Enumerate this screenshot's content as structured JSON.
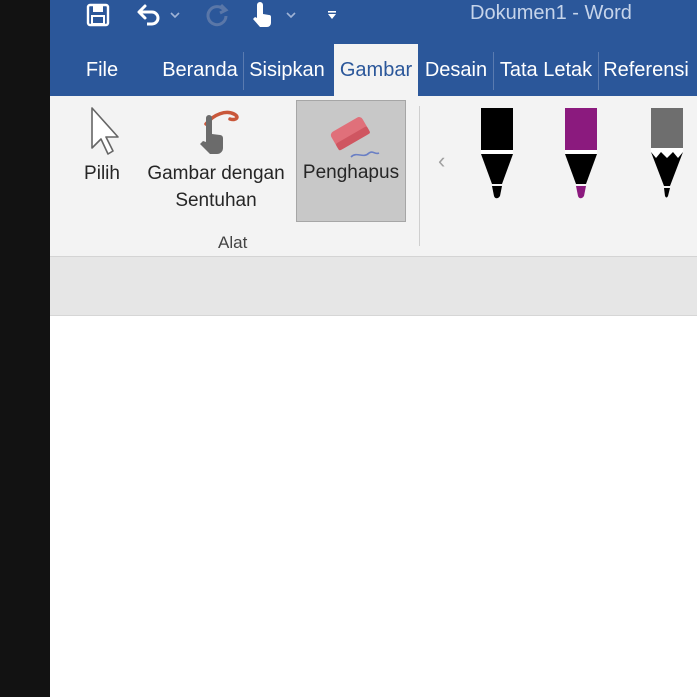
{
  "window": {
    "title": "Dokumen1  -  Word"
  },
  "quick_access": {
    "save_icon": "save-icon",
    "undo_icon": "undo-icon",
    "redo_icon": "redo-icon",
    "touch_mode_icon": "touch-mode-icon",
    "customize_icon": "customize-toolbar-icon"
  },
  "tabs": [
    {
      "label": "File"
    },
    {
      "label": "Beranda"
    },
    {
      "label": "Sisipkan"
    },
    {
      "label": "Gambar",
      "active": true
    },
    {
      "label": "Desain"
    },
    {
      "label": "Tata Letak"
    },
    {
      "label": "Referensi"
    }
  ],
  "ribbon": {
    "tools_group": {
      "label": "Alat",
      "select": {
        "label": "Pilih"
      },
      "touch_draw": {
        "line1": "Gambar dengan",
        "line2": "Sentuhan"
      },
      "eraser": {
        "label": "Penghapus",
        "selected": true
      }
    },
    "pens": [
      {
        "name": "pen-black",
        "color": "#000000"
      },
      {
        "name": "pen-purple",
        "color": "#8b1a7e"
      },
      {
        "name": "pencil-gray",
        "color": "#6e6e6e"
      }
    ]
  },
  "colors": {
    "accent": "#2b579a",
    "ribbon_bg": "#f3f3f3"
  }
}
